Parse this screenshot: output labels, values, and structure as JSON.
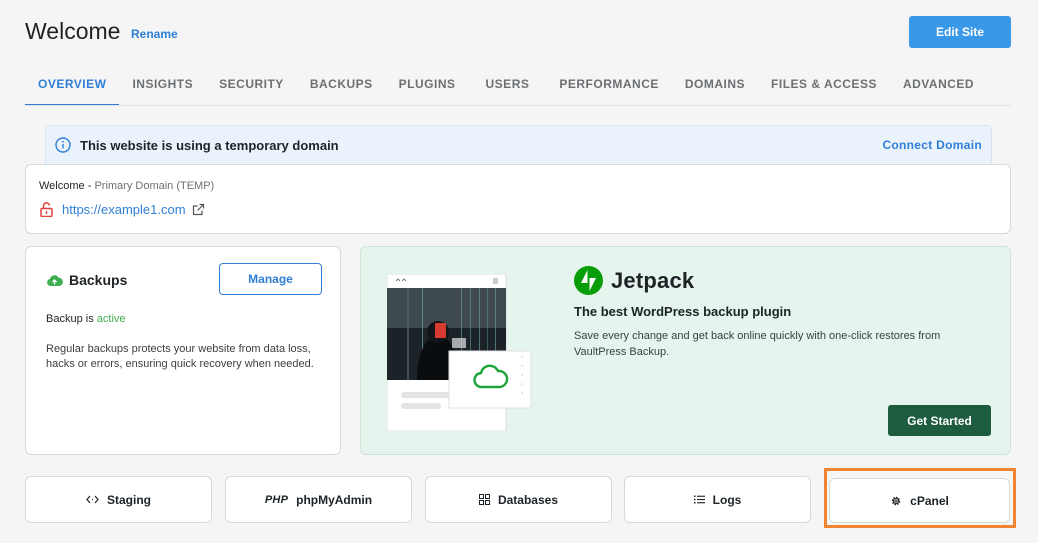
{
  "header": {
    "title": "Welcome",
    "rename_label": "Rename",
    "edit_site_label": "Edit Site"
  },
  "tabs": [
    {
      "label": "OVERVIEW",
      "active": true
    },
    {
      "label": "INSIGHTS"
    },
    {
      "label": "SECURITY"
    },
    {
      "label": "BACKUPS"
    },
    {
      "label": "PLUGINS"
    },
    {
      "label": "USERS"
    },
    {
      "label": "PERFORMANCE"
    },
    {
      "label": "DOMAINS"
    },
    {
      "label": "FILES & ACCESS"
    },
    {
      "label": "ADVANCED"
    }
  ],
  "banner": {
    "icon": "info-icon",
    "text": "This website is using a temporary domain",
    "link_label": "Connect Domain"
  },
  "domain": {
    "site_name": "Welcome -",
    "domain_type": "Primary Domain (TEMP)",
    "url": "https://example1.com",
    "lock_icon": "lock-open-icon",
    "link_icon": "external-link-icon"
  },
  "backups": {
    "title": "Backups",
    "manage_label": "Manage",
    "status_prefix": "Backup is",
    "status_value": "active",
    "description": "Regular backups protects your website from data loss, hacks or errors, ensuring quick recovery when needed."
  },
  "jetpack": {
    "brand": "Jetpack",
    "headline": "The best WordPress backup plugin",
    "description": "Save every change and get back online quickly with one-click restores from VaultPress Backup.",
    "cta_label": "Get Started"
  },
  "tools": [
    {
      "label": "Staging",
      "icon": "code-icon"
    },
    {
      "label": "phpMyAdmin",
      "icon": "php-icon",
      "icon_text": "PHP"
    },
    {
      "label": "Databases",
      "icon": "grid-icon"
    },
    {
      "label": "Logs",
      "icon": "list-icon"
    },
    {
      "label": "cPanel",
      "icon": "gear-icon",
      "highlighted": true
    }
  ],
  "colors": {
    "accent": "#2f7fd6",
    "primary_button": "#3a98e8",
    "jetpack_green": "#069e08",
    "jetpack_button": "#1d5c3f",
    "active_status": "#3fae4f",
    "highlight": "#ef8433"
  }
}
